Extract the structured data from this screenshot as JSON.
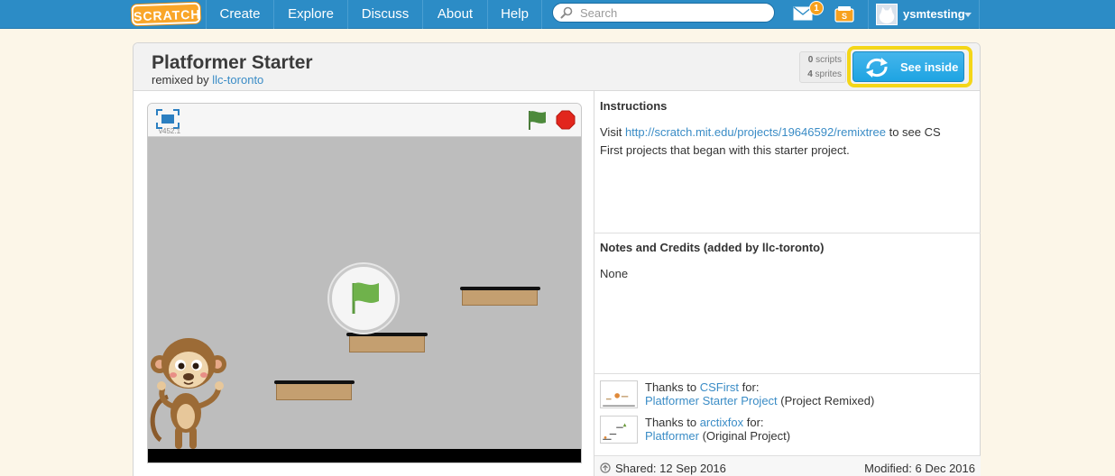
{
  "nav": {
    "logo": "SCRATCH",
    "items": [
      "Create",
      "Explore",
      "Discuss",
      "About",
      "Help"
    ],
    "search_placeholder": "Search",
    "messages_count": "1",
    "username": "ysmtesting"
  },
  "project": {
    "title": "Platformer Starter",
    "remixed_by_prefix": "remixed by ",
    "remixed_by_user": "llc-toronto",
    "scripts_count": "0",
    "scripts_label": "scripts",
    "sprites_count": "4",
    "sprites_label": "sprites",
    "see_inside_label": "See inside",
    "player_version": "v452.1"
  },
  "instructions": {
    "heading": "Instructions",
    "text_before": "Visit ",
    "link": "http://scratch.mit.edu/projects/19646592/remixtree",
    "text_after": " to see CS First projects that began with this starter project."
  },
  "notes": {
    "heading": "Notes and Credits (added by llc-toronto)",
    "text": "None"
  },
  "credits": [
    {
      "thanks": "Thanks to ",
      "user": "CSFirst",
      "for": " for:",
      "project": "Platformer Starter Project",
      "kind": " (Project Remixed)"
    },
    {
      "thanks": "Thanks to ",
      "user": "arctixfox",
      "for": " for:",
      "project": "Platformer",
      "kind": " (Original Project)"
    }
  ],
  "footer": {
    "shared": "Shared: 12 Sep 2016",
    "modified": "Modified: 6 Dec 2016"
  },
  "colors": {
    "nav_blue": "#2c8cc6",
    "button_blue": "#1ea4e2",
    "highlight_yellow": "#f4d618",
    "link_blue": "#3a8cc6"
  }
}
